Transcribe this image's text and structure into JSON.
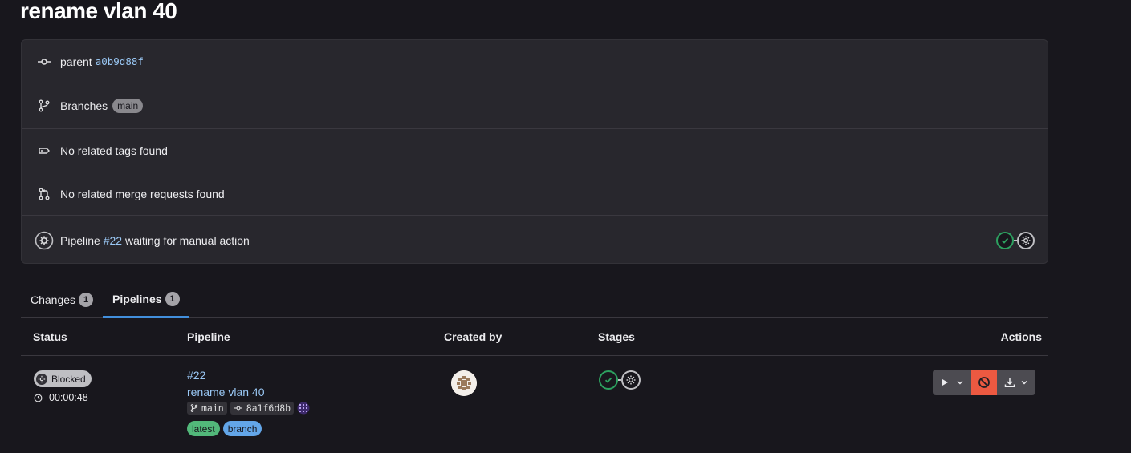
{
  "page": {
    "title": "rename vlan 40"
  },
  "info": {
    "parent_label": "parent",
    "parent_sha": "a0b9d88f",
    "branches_label": "Branches",
    "branch_name": "main",
    "tags_text": "No related tags found",
    "mr_text": "No related merge requests found",
    "pipeline_prefix": "Pipeline",
    "pipeline_id": "#22",
    "pipeline_suffix": "waiting for manual action"
  },
  "tabs": [
    {
      "label": "Changes",
      "count": "1"
    },
    {
      "label": "Pipelines",
      "count": "1"
    }
  ],
  "table": {
    "headers": {
      "status": "Status",
      "pipeline": "Pipeline",
      "created_by": "Created by",
      "stages": "Stages",
      "actions": "Actions"
    },
    "row": {
      "status": "Blocked",
      "duration": "00:00:48",
      "pipeline_id": "#22",
      "title": "rename vlan 40",
      "ref": "main",
      "commit": "8a1f6d8b",
      "labels": [
        "latest",
        "branch"
      ]
    }
  },
  "colors": {
    "success": "#2da160",
    "link": "#9ac8f5",
    "danger": "#ec5941",
    "tab_active": "#428fdc"
  },
  "icons": [
    "commit-icon",
    "branch-icon",
    "tag-icon",
    "merge-request-icon",
    "status-manual-icon",
    "status-success-icon",
    "clock-icon",
    "play-icon",
    "cancel-icon",
    "download-icon",
    "chevron-down-icon",
    "identicon"
  ]
}
